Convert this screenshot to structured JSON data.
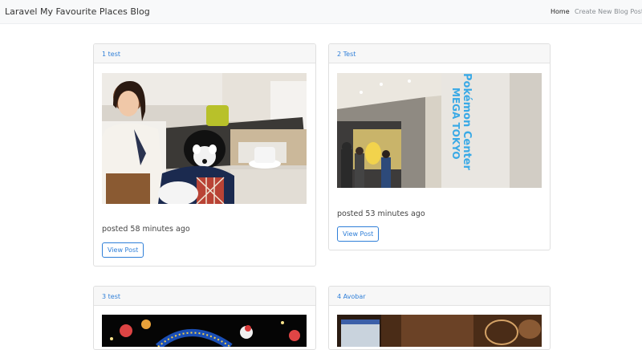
{
  "navbar": {
    "brand": "Laravel My Favourite Places Blog",
    "links": [
      {
        "label": "Home"
      },
      {
        "label": "Create New Blog Post"
      }
    ]
  },
  "posts": [
    {
      "title": "1 test",
      "posted": "posted 58 minutes ago",
      "button": "View Post"
    },
    {
      "title": "2 Test",
      "posted": "posted 53 minutes ago",
      "button": "View Post"
    },
    {
      "title": "3 test"
    },
    {
      "title": "4 Avobar"
    }
  ],
  "images": {
    "post2_sign": "Pokémon Center MEGA TOKYO"
  },
  "colors": {
    "link": "#2f7fd8",
    "navbar_bg": "#f8f9fa",
    "card_header_bg": "#f7f7f7"
  }
}
